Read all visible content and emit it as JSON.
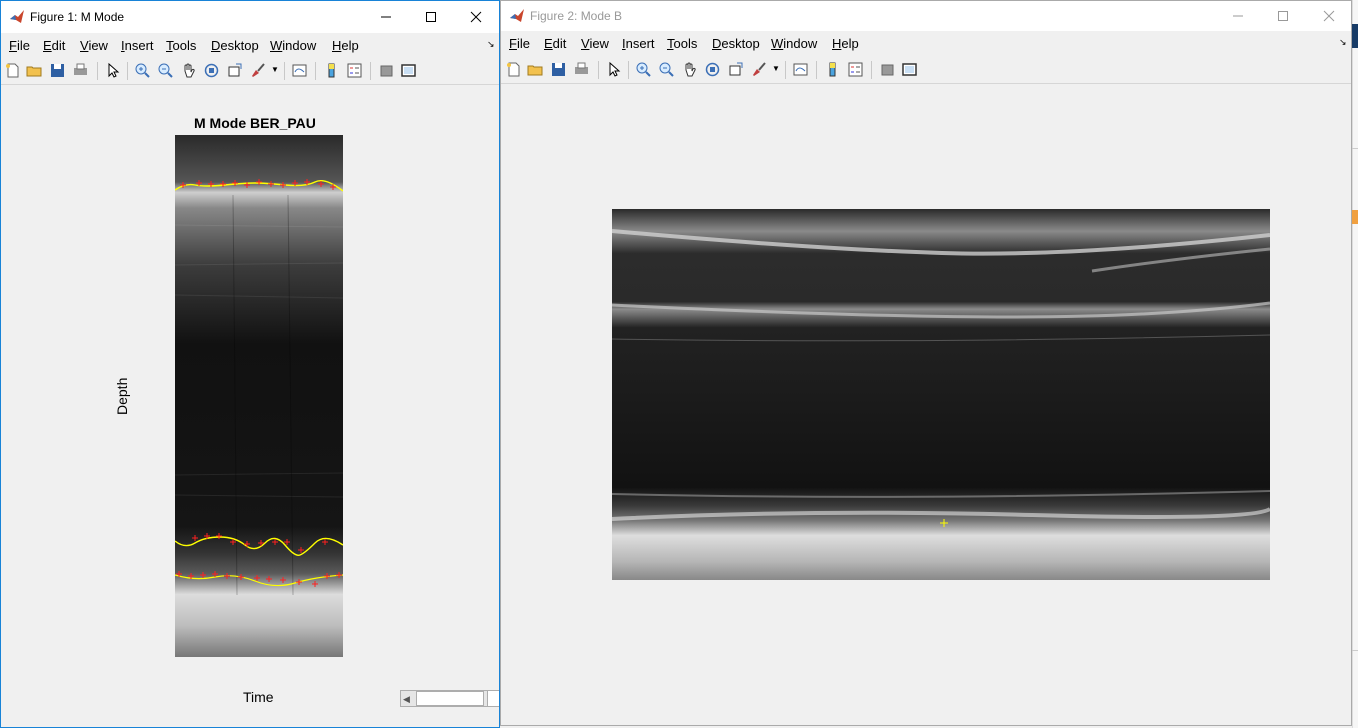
{
  "figure1": {
    "title": "Figure 1: M Mode",
    "menu": [
      "File",
      "Edit",
      "View",
      "Insert",
      "Tools",
      "Desktop",
      "Window",
      "Help"
    ],
    "plot_title": "M Mode BER_PAU",
    "ylabel": "Depth",
    "xlabel": "Time",
    "icons": [
      "new-figure-icon",
      "open-file-icon",
      "save-icon",
      "print-icon",
      "pointer-icon",
      "zoom-in-icon",
      "zoom-out-icon",
      "pan-icon",
      "rotate-3d-icon",
      "data-cursor-icon",
      "brush-icon",
      "link-plot-icon",
      "colorbar-icon",
      "legend-icon",
      "hide-plot-tools-icon",
      "show-plot-tools-icon"
    ]
  },
  "figure2": {
    "title": "Figure 2: Mode B",
    "menu": [
      "File",
      "Edit",
      "View",
      "Insert",
      "Tools",
      "Desktop",
      "Window",
      "Help"
    ]
  },
  "colors": {
    "trace_line": "#ffff00",
    "trace_marker": "#ff0000",
    "active_border": "#1883d7"
  }
}
